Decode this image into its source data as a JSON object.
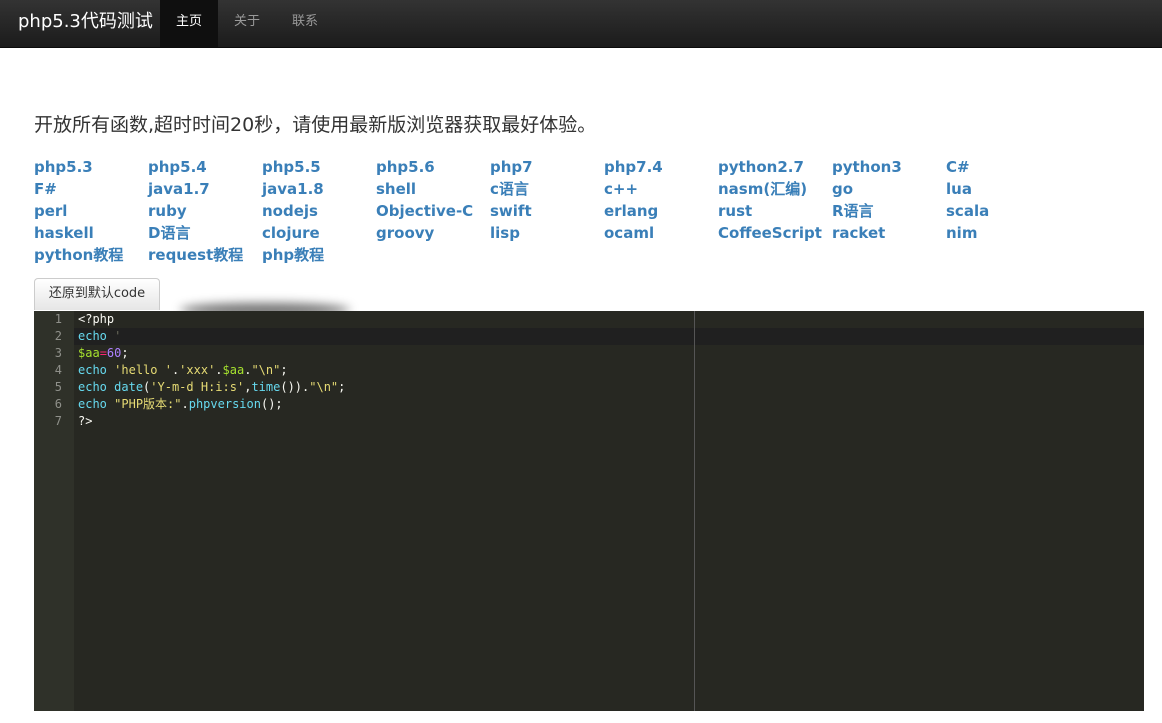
{
  "navbar": {
    "brand": "php5.3代码测试",
    "items": [
      "主页",
      "关于",
      "联系"
    ]
  },
  "intro": "开放所有函数,超时时间20秒，请使用最新版浏览器获取最好体验。",
  "languages": [
    [
      "php5.3",
      "php5.4",
      "php5.5",
      "php5.6",
      "php7",
      "php7.4",
      "python2.7",
      "python3",
      "C#"
    ],
    [
      "F#",
      "java1.7",
      "java1.8",
      "shell",
      "c语言",
      "c++",
      "nasm(汇编)",
      "go",
      "lua"
    ],
    [
      "perl",
      "ruby",
      "nodejs",
      "Objective-C",
      "swift",
      "erlang",
      "rust",
      "R语言",
      "scala"
    ],
    [
      "haskell",
      "D语言",
      "clojure",
      "groovy",
      "lisp",
      "ocaml",
      "CoffeeScript",
      "racket",
      "nim"
    ],
    [
      "python教程",
      "request教程",
      "php教程"
    ]
  ],
  "reset_button": "还原到默认code",
  "editor": {
    "line_numbers": [
      "1",
      "2",
      "3",
      "4",
      "5",
      "6",
      "7"
    ],
    "lines": [
      "<?php",
      "echo '",
      "$aa=60;",
      "echo 'hello '.'xxx'.$aa.\"\\n\";",
      "echo date('Y-m-d H:i:s',time()).\"\\n\";",
      "echo \"PHP版本:\".phpversion();",
      "?>"
    ],
    "colors": {
      "background": "#272822",
      "keyword": "#66d9ef",
      "string": "#e6db74",
      "variable": "#a6e22e",
      "number": "#ae81ff"
    }
  }
}
